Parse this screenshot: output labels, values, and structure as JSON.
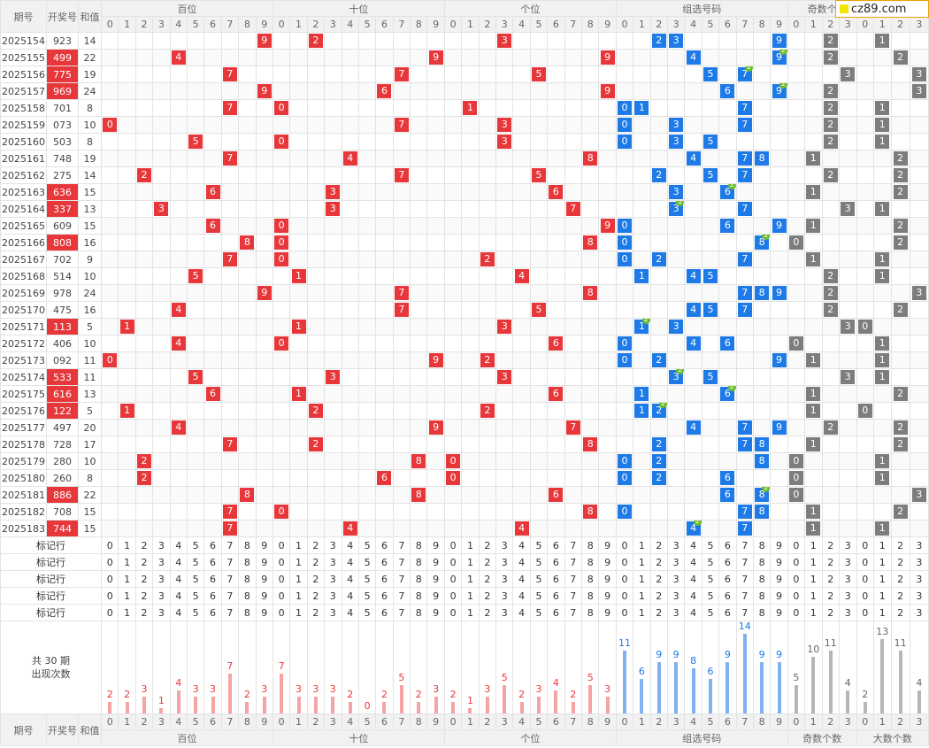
{
  "logo": {
    "text": "cz89.com"
  },
  "header": {
    "period": "期号",
    "code": "开奖号",
    "sum": "和值",
    "groups": {
      "bai": "百位",
      "shi": "十位",
      "ge": "个位",
      "zu": "组选号码",
      "odd": "奇数个",
      "odd_full": "奇数个数",
      "big": "大数个数"
    }
  },
  "marker_label": "标记行",
  "summary": {
    "line1": "共 30 期",
    "line2": "出现次数"
  },
  "chart_data": {
    "type": "table",
    "rows": [
      {
        "period": "2025154",
        "code": "923",
        "sum": 14,
        "repeat": []
      },
      {
        "period": "2025155",
        "code": "499",
        "sum": 22,
        "repeat": [
          9
        ]
      },
      {
        "period": "2025156",
        "code": "775",
        "sum": 19,
        "repeat": [
          7
        ]
      },
      {
        "period": "2025157",
        "code": "969",
        "sum": 24,
        "repeat": [
          9
        ]
      },
      {
        "period": "2025158",
        "code": "701",
        "sum": 8,
        "repeat": []
      },
      {
        "period": "2025159",
        "code": "073",
        "sum": 10,
        "repeat": []
      },
      {
        "period": "2025160",
        "code": "503",
        "sum": 8,
        "repeat": []
      },
      {
        "period": "2025161",
        "code": "748",
        "sum": 19,
        "repeat": []
      },
      {
        "period": "2025162",
        "code": "275",
        "sum": 14,
        "repeat": []
      },
      {
        "period": "2025163",
        "code": "636",
        "sum": 15,
        "repeat": [
          6
        ]
      },
      {
        "period": "2025164",
        "code": "337",
        "sum": 13,
        "repeat": [
          3
        ]
      },
      {
        "period": "2025165",
        "code": "609",
        "sum": 15,
        "repeat": []
      },
      {
        "period": "2025166",
        "code": "808",
        "sum": 16,
        "repeat": [
          8
        ]
      },
      {
        "period": "2025167",
        "code": "702",
        "sum": 9,
        "repeat": []
      },
      {
        "period": "2025168",
        "code": "514",
        "sum": 10,
        "repeat": []
      },
      {
        "period": "2025169",
        "code": "978",
        "sum": 24,
        "repeat": []
      },
      {
        "period": "2025170",
        "code": "475",
        "sum": 16,
        "repeat": []
      },
      {
        "period": "2025171",
        "code": "113",
        "sum": 5,
        "repeat": [
          1
        ]
      },
      {
        "period": "2025172",
        "code": "406",
        "sum": 10,
        "repeat": []
      },
      {
        "period": "2025173",
        "code": "092",
        "sum": 11,
        "repeat": []
      },
      {
        "period": "2025174",
        "code": "533",
        "sum": 11,
        "repeat": [
          3
        ]
      },
      {
        "period": "2025175",
        "code": "616",
        "sum": 13,
        "repeat": [
          6
        ]
      },
      {
        "period": "2025176",
        "code": "122",
        "sum": 5,
        "repeat": [
          2
        ]
      },
      {
        "period": "2025177",
        "code": "497",
        "sum": 20,
        "repeat": []
      },
      {
        "period": "2025178",
        "code": "728",
        "sum": 17,
        "repeat": []
      },
      {
        "period": "2025179",
        "code": "280",
        "sum": 10,
        "repeat": []
      },
      {
        "period": "2025180",
        "code": "260",
        "sum": 8,
        "repeat": []
      },
      {
        "period": "2025181",
        "code": "886",
        "sum": 22,
        "repeat": [
          8
        ]
      },
      {
        "period": "2025182",
        "code": "708",
        "sum": 15,
        "repeat": []
      },
      {
        "period": "2025183",
        "code": "744",
        "sum": 15,
        "repeat": [
          4
        ]
      }
    ],
    "occurrence_counts": {
      "bai": [
        2,
        2,
        3,
        1,
        4,
        3,
        3,
        7,
        2,
        3
      ],
      "shi": [
        7,
        3,
        3,
        3,
        2,
        0,
        2,
        5,
        2,
        3
      ],
      "ge": [
        2,
        1,
        3,
        5,
        2,
        3,
        4,
        2,
        5,
        3
      ],
      "zu": [
        11,
        6,
        9,
        9,
        8,
        6,
        9,
        14,
        9,
        9
      ],
      "odd": [
        5,
        10,
        11,
        4
      ],
      "big": [
        2,
        13,
        11,
        4
      ]
    },
    "red_code_periods": [
      "2025155",
      "2025156",
      "2025157",
      "2025163",
      "2025164",
      "2025166",
      "2025171",
      "2025174",
      "2025175",
      "2025176",
      "2025181",
      "2025183"
    ],
    "colors": {
      "digit_ball": "#e8373a",
      "group_ball": "#1d7ae6",
      "count_ball": "#7d7d7d",
      "repeat_badge": "#6cbe2b"
    }
  }
}
